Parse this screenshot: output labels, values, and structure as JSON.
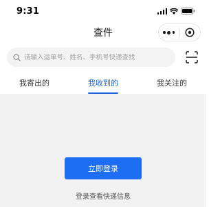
{
  "status_bar": {
    "time": "9:31"
  },
  "nav": {
    "title": "查件"
  },
  "search": {
    "placeholder": "请输入运单号、姓名、手机号快递查找",
    "value": ""
  },
  "tabs": [
    {
      "label": "我寄出的",
      "active": false
    },
    {
      "label": "我收到的",
      "active": true
    },
    {
      "label": "我关注的",
      "active": false
    }
  ],
  "content": {
    "login_button_label": "立即登录",
    "login_hint": "登录查看快递信息"
  },
  "colors": {
    "accent": "#1e6ef4",
    "active_tab": "#1a66e0",
    "background": "#f2f2f2"
  }
}
